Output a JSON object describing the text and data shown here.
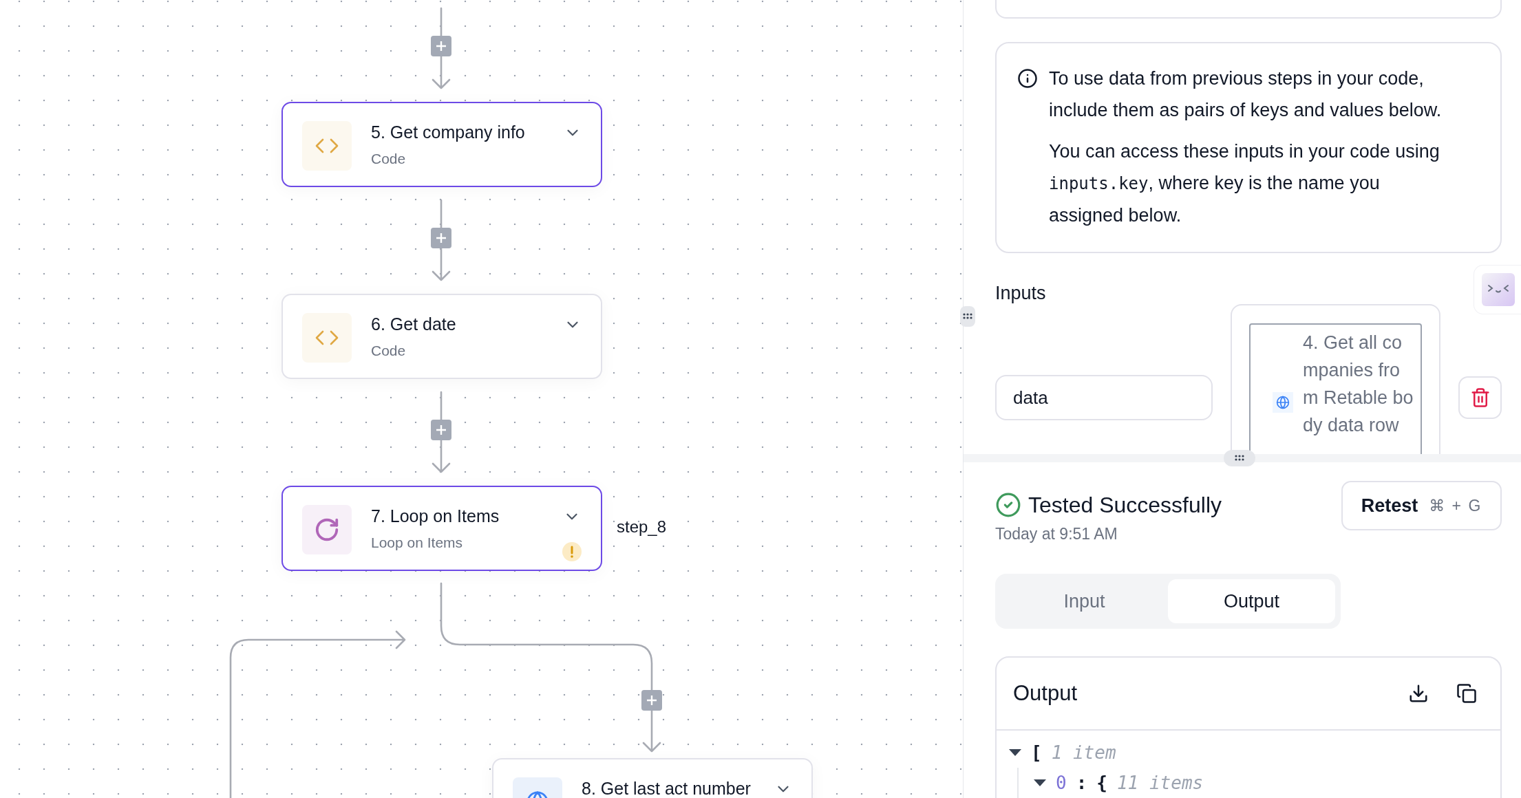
{
  "canvas": {
    "steps": [
      {
        "title": "5. Get company info",
        "subtitle": "Code",
        "kind": "code",
        "selected": true,
        "warning": false
      },
      {
        "title": "6. Get date",
        "subtitle": "Code",
        "kind": "code",
        "selected": false,
        "warning": false
      },
      {
        "title": "7. Loop on Items",
        "subtitle": "Loop on Items",
        "kind": "loop",
        "selected": true,
        "warning": true
      },
      {
        "title": "8. Get last act number",
        "kind": "http",
        "selected": false,
        "warning": false
      }
    ],
    "branch_label": "step_8"
  },
  "info": {
    "paragraphs": [
      {
        "text": "To use data from previous steps in your code, include them as pairs of keys and values below."
      },
      {
        "text": "You can access these inputs in your code using ",
        "code": "inputs.key",
        "after": ", where key is the name you assigned below."
      }
    ]
  },
  "inputs": {
    "label": "Inputs",
    "rows": [
      {
        "key": "data",
        "value": "4. Get all companies from Retable body data row"
      }
    ]
  },
  "test": {
    "status": "Tested Successfully",
    "success": true,
    "time": "Today at 9:51 AM",
    "retest": "Retest",
    "shortcut": "⌘ + G"
  },
  "tabs": [
    {
      "label": "Input",
      "selected": false
    },
    {
      "label": "Output",
      "selected": true
    }
  ],
  "output": {
    "title": "Output",
    "tree": [
      {
        "bracket": "[",
        "hint": "1 item",
        "expanded": true,
        "children": [
          {
            "key": "0",
            "separator": ":",
            "bracket": "{",
            "hint": "11 items",
            "expanded": true
          }
        ]
      }
    ]
  }
}
